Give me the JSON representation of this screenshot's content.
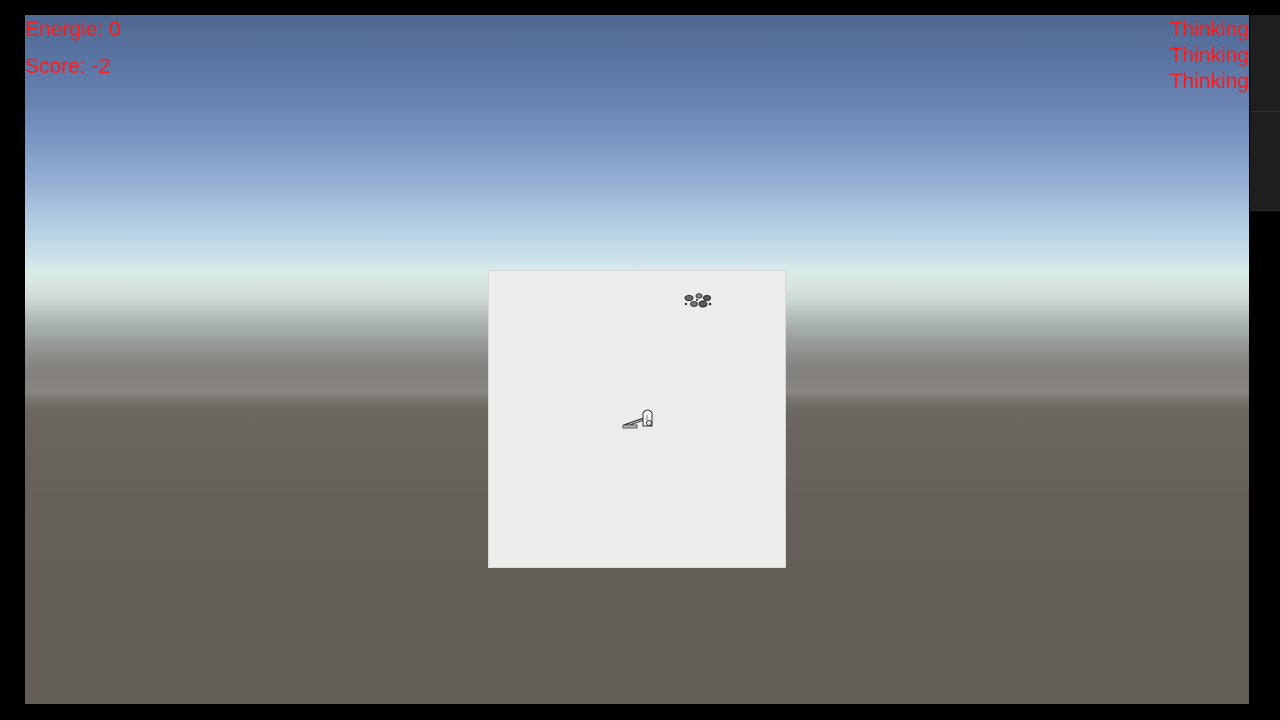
{
  "hud": {
    "energy_text": "Energie: 0",
    "score_text": "Score: -2",
    "status_lines": [
      "Thinking",
      "Thinking",
      "Thinking"
    ]
  },
  "colors": {
    "hud_text": "#ff1a1a",
    "board": "#ececec",
    "letterbox": "#000000"
  },
  "scene": {
    "board_items": [
      {
        "name": "dirt",
        "icon": "dirt-pile-icon"
      },
      {
        "name": "vacuum",
        "icon": "vacuum-cleaner-icon"
      }
    ]
  }
}
